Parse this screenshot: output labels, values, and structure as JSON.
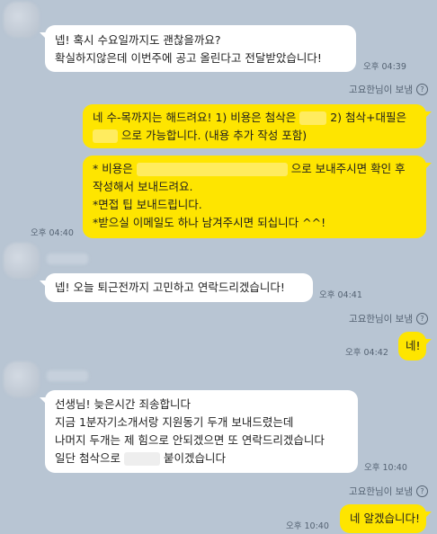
{
  "colors": {
    "background": "#b8c5d3",
    "incoming_bubble": "#ffffff",
    "outgoing_bubble": "#fee500",
    "meta_text": "#556373"
  },
  "status_label": "고요한님이 보냄",
  "status_icon": "question-circle-icon",
  "messages": {
    "m1": {
      "lines": [
        "넵! 혹시 수요일까지도 괜찮을까요?",
        "확실하지않은데 이번주에 공고 올린다고 전달받았습니다!"
      ],
      "time": "오후 04:39"
    },
    "m2": {
      "l1a": "네 수-목까지는 해드려요! 1) 비용은 첨삭은",
      "l1b": "2) 첨삭+대필은",
      "l2": "으로 가능합니다. (내용 추가 작성 포함)"
    },
    "m3": {
      "l1a": "* 비용은",
      "l1b": "으로 보내주시면 확인 후",
      "lines": [
        "작성해서 보내드려요.",
        "*면접 팁 보내드립니다.",
        "*받으실 이메일도 하나 남겨주시면 되십니다 ^^!"
      ],
      "time": "오후 04:40"
    },
    "m4": {
      "text": "넵! 오늘 퇴근전까지 고민하고 연락드리겠습니다!",
      "time": "오후 04:41"
    },
    "m5": {
      "text": "네!",
      "time": "오후 04:42"
    },
    "m6": {
      "lines": [
        "선생님! 늦은시간 죄송합니다",
        "지금 1분자기소개서랑 지원동기 두개 보내드렸는데",
        "나머지 두개는 제 힘으로 안되겠으면 또 연락드리겠습니다"
      ],
      "l4a": "일단 첨삭으로",
      "l4b": "붙이겠습니다",
      "time": "오후 10:40"
    },
    "m7": {
      "text": "네 알겠습니다!",
      "time": "오후 10:40"
    }
  }
}
